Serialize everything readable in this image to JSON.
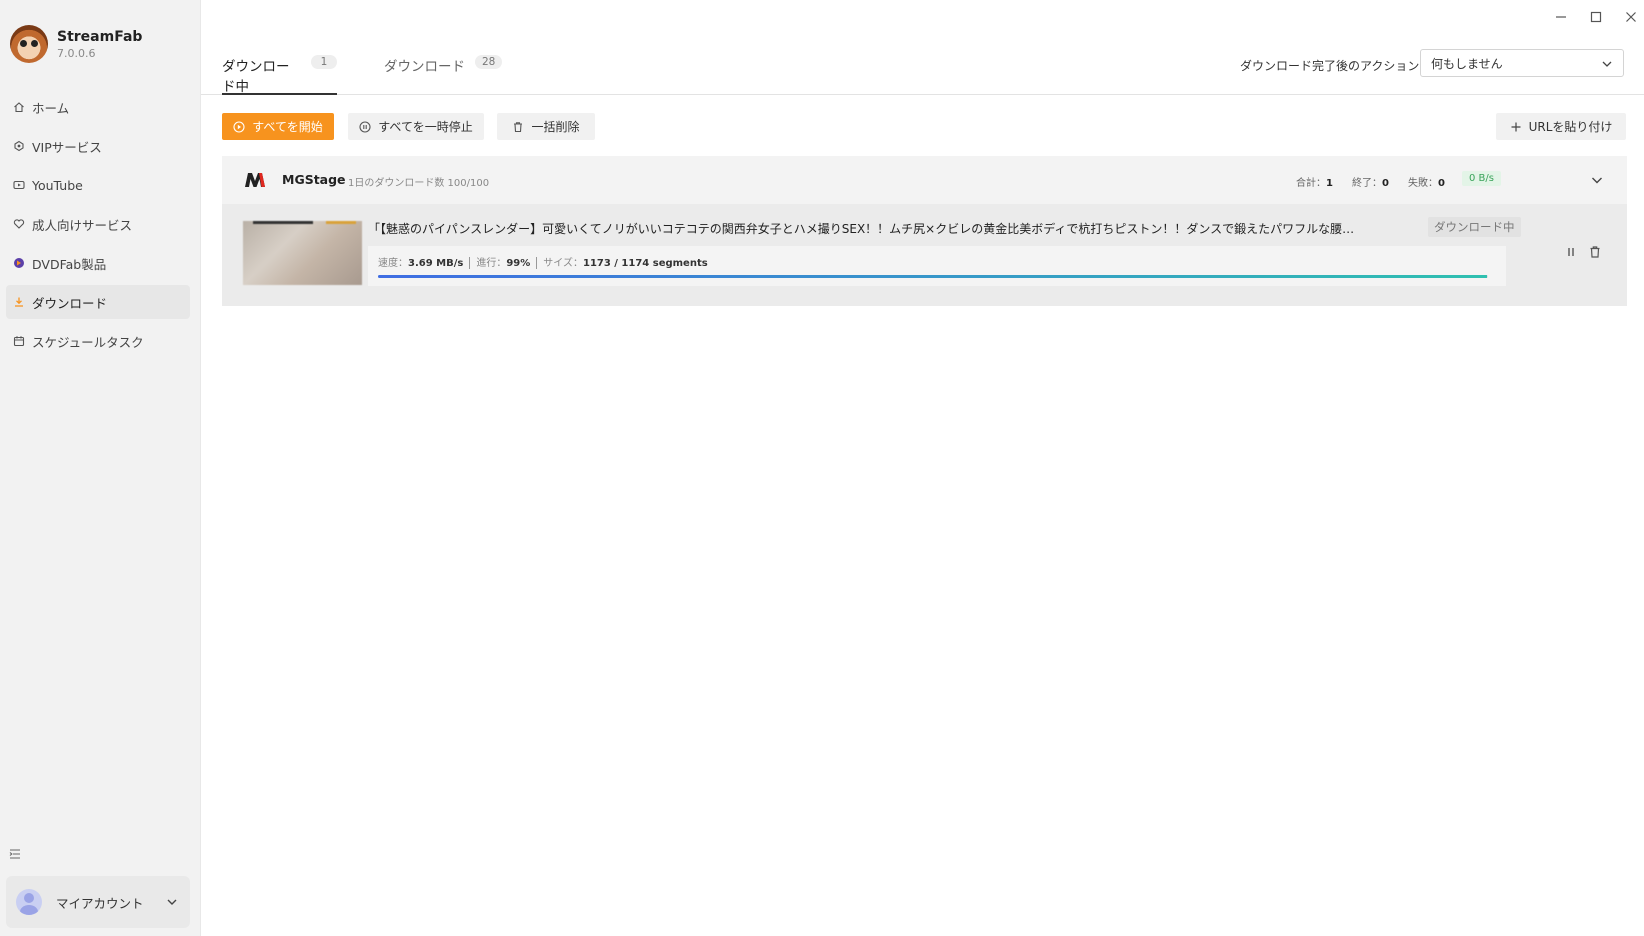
{
  "app": {
    "name": "StreamFab",
    "version": "7.0.0.6"
  },
  "sidebar": {
    "items": [
      {
        "label": "ホーム",
        "icon": "home-icon"
      },
      {
        "label": "VIPサービス",
        "icon": "vip-icon"
      },
      {
        "label": "YouTube",
        "icon": "youtube-icon"
      },
      {
        "label": "成人向けサービス",
        "icon": "heart-icon"
      },
      {
        "label": "DVDFab製品",
        "icon": "dvdfab-icon"
      },
      {
        "label": "ダウンロード",
        "icon": "download-icon"
      },
      {
        "label": "スケジュールタスク",
        "icon": "calendar-icon"
      }
    ],
    "active_index": 5,
    "account_label": "マイアカウント"
  },
  "tabs": [
    {
      "label": "ダウンロード中",
      "count": "1"
    },
    {
      "label": "ダウンロード",
      "count": "28"
    }
  ],
  "after_action": {
    "label": "ダウンロード完了後のアクション：",
    "value": "何もしません"
  },
  "toolbar": {
    "start_all": "すべてを開始",
    "pause_all": "すべてを一時停止",
    "delete_all": "一括削除",
    "paste_url": "URLを貼り付け"
  },
  "group": {
    "name": "MGStage",
    "quota": "1日のダウンロード数 100/100",
    "total_label": "合計：",
    "total": "1",
    "done_label": "終了：",
    "done": "0",
    "failed_label": "失敗：",
    "failed": "0",
    "speed": "0 B/s"
  },
  "item": {
    "title": "「【魅惑のパイパンスレンダー】可愛いくてノリがいいコテコテの関西弁女子とハメ撮りSEX！！ムチ尻×クビレの黄金比美ボディで杭打ちピストン！！ダンスで鍛えたパワフルな腰使…」：MGS動画＜プレステー...",
    "status": "ダウンロード中",
    "speed_label": "速度：",
    "speed": "3.69 MB/s",
    "progress_label": "進行：",
    "progress": "99%",
    "size_label": "サイズ：",
    "size": "1173 / 1174 segments",
    "progress_fraction": 0.999
  },
  "colors": {
    "accent": "#f7931e",
    "speed_green": "#3aa35a",
    "progress_start": "#3f6de3",
    "progress_end": "#2fc0b0"
  }
}
